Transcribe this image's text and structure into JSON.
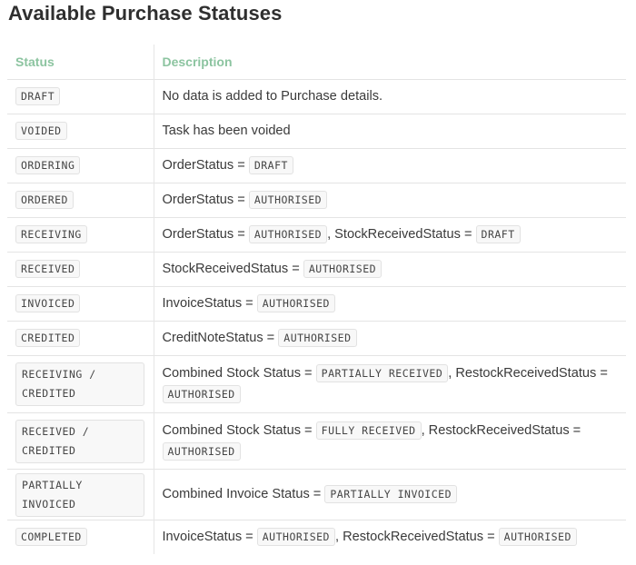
{
  "title": "Available Purchase Statuses",
  "headers": {
    "status": "Status",
    "description": "Description"
  },
  "rows": [
    {
      "status": "DRAFT",
      "parts": [
        {
          "text": "No data is added to Purchase details."
        }
      ]
    },
    {
      "status": "VOIDED",
      "parts": [
        {
          "text": "Task has been voided"
        }
      ]
    },
    {
      "status": "ORDERING",
      "parts": [
        {
          "text": "OrderStatus = "
        },
        {
          "code": "DRAFT"
        }
      ]
    },
    {
      "status": "ORDERED",
      "parts": [
        {
          "text": "OrderStatus = "
        },
        {
          "code": "AUTHORISED"
        }
      ]
    },
    {
      "status": "RECEIVING",
      "parts": [
        {
          "text": "OrderStatus = "
        },
        {
          "code": "AUTHORISED"
        },
        {
          "text": ", StockReceivedStatus = "
        },
        {
          "code": "DRAFT"
        }
      ]
    },
    {
      "status": "RECEIVED",
      "parts": [
        {
          "text": "StockReceivedStatus = "
        },
        {
          "code": "AUTHORISED"
        }
      ]
    },
    {
      "status": "INVOICED",
      "parts": [
        {
          "text": "InvoiceStatus = "
        },
        {
          "code": "AUTHORISED"
        }
      ]
    },
    {
      "status": "CREDITED",
      "parts": [
        {
          "text": "CreditNoteStatus = "
        },
        {
          "code": "AUTHORISED"
        }
      ]
    },
    {
      "status": "RECEIVING / CREDITED",
      "parts": [
        {
          "text": "Combined Stock Status = "
        },
        {
          "code": "PARTIALLY RECEIVED"
        },
        {
          "text": ", RestockReceivedStatus = "
        },
        {
          "code": "AUTHORISED"
        }
      ]
    },
    {
      "status": "RECEIVED / CREDITED",
      "parts": [
        {
          "text": "Combined Stock Status = "
        },
        {
          "code": "FULLY RECEIVED"
        },
        {
          "text": ", RestockReceivedStatus = "
        },
        {
          "code": "AUTHORISED"
        }
      ]
    },
    {
      "status": "PARTIALLY INVOICED",
      "parts": [
        {
          "text": "Combined Invoice Status = "
        },
        {
          "code": "PARTIALLY INVOICED"
        }
      ]
    },
    {
      "status": "COMPLETED",
      "parts": [
        {
          "text": "InvoiceStatus = "
        },
        {
          "code": "AUTHORISED"
        },
        {
          "text": ", RestockReceivedStatus = "
        },
        {
          "code": "AUTHORISED"
        }
      ]
    }
  ]
}
